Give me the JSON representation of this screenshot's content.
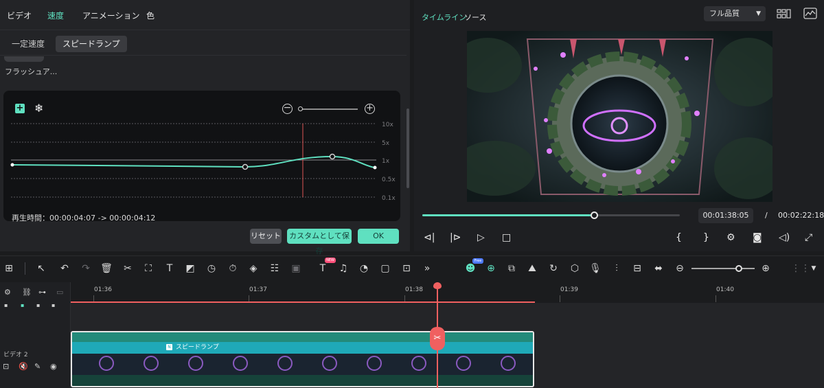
{
  "left_panel": {
    "tabs": [
      "ビデオ",
      "速度",
      "アニメーション",
      "色"
    ],
    "subtabs": [
      "一定速度",
      "スピードランプ"
    ],
    "preset_label": "フラッシュア...",
    "curve_labels": [
      "10x",
      "5x",
      "1x",
      "0.5x",
      "0.1x"
    ],
    "playtime": "再生時間：00:00:04:07 -> 00:00:04:12",
    "buttons": {
      "reset": "リセット",
      "save_custom": "カスタムとして保存",
      "ok": "OK"
    }
  },
  "right_panel": {
    "tabs": [
      "タイムライン",
      "ソース"
    ],
    "quality": "フル品質",
    "playback_progress": 0.667,
    "current_time": "00:01:38:05",
    "separator": "/",
    "total_time": "00:02:22:18"
  },
  "toolbar": {
    "badge_new": "NEW",
    "badge_free": "Free"
  },
  "timeline": {
    "ruler_labels": [
      "01:36",
      "01:37",
      "01:38",
      "01:39",
      "01:40"
    ],
    "track_name": "ビデオ 2",
    "clip_title": "スピードランプ"
  },
  "colors": {
    "accent": "#5fe0c0",
    "playhead": "#f06060",
    "clip_title": "#1fa9b8"
  }
}
